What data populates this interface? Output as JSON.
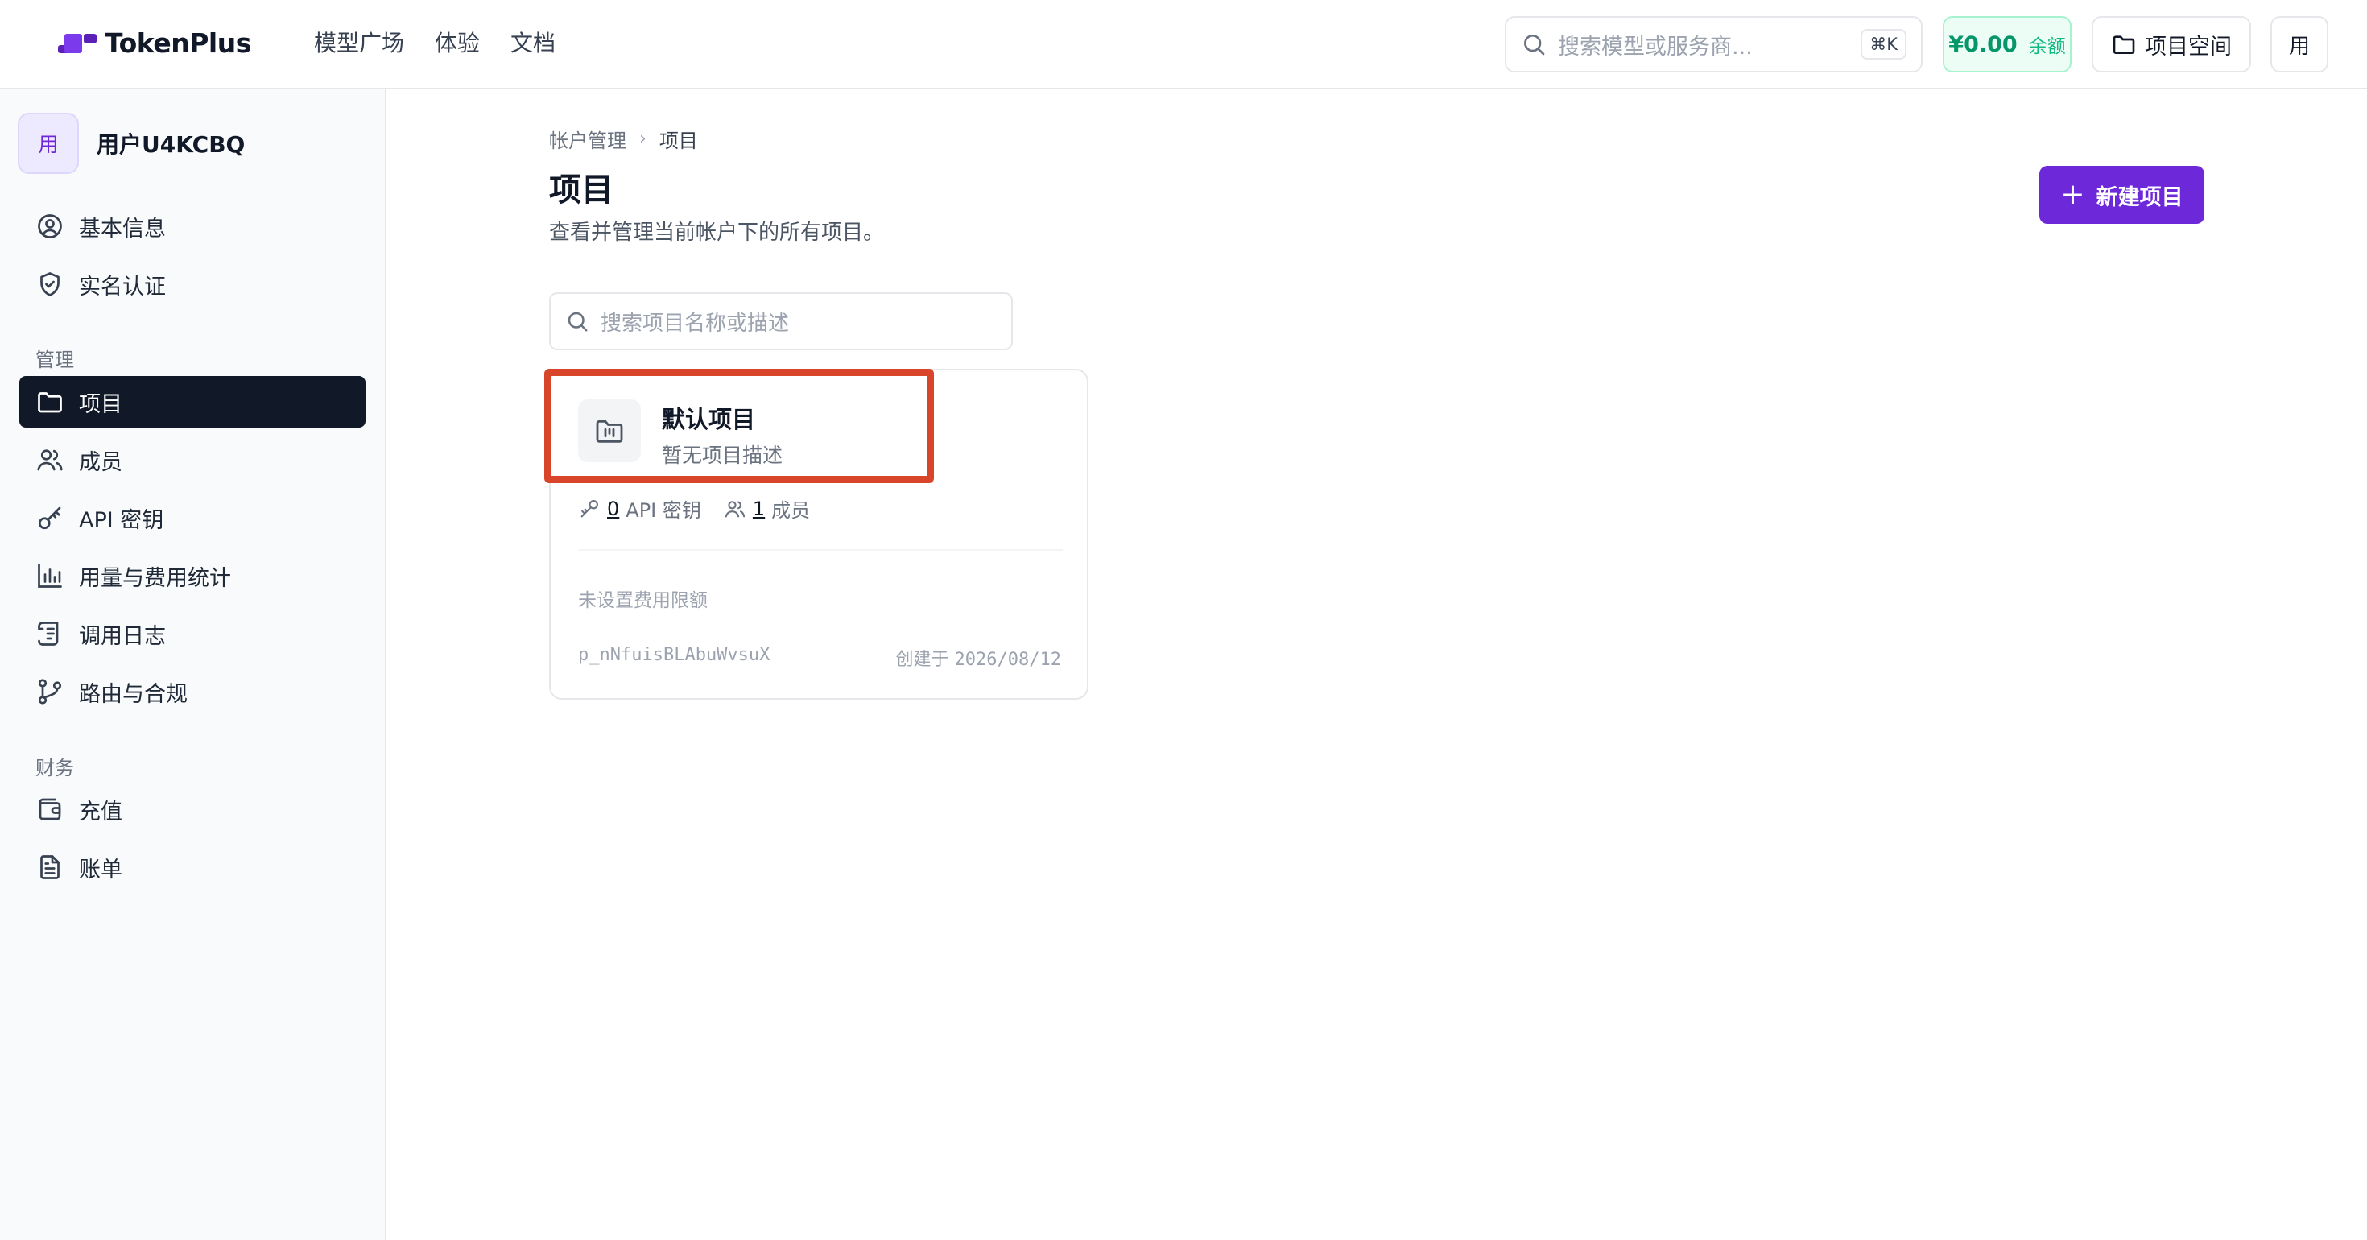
{
  "header": {
    "logo_text": "TokenPlus",
    "nav": [
      "模型广场",
      "体验",
      "文档"
    ],
    "search_placeholder": "搜索模型或服务商...",
    "search_shortcut": "⌘K",
    "balance_amount": "¥0.00",
    "balance_label": "余额",
    "workspace_label": "项目空间",
    "user_initial": "用"
  },
  "sidebar": {
    "avatar": "用",
    "username": "用户U4KCBQ",
    "items_top": [
      {
        "label": "基本信息",
        "icon": "user-circle-icon"
      },
      {
        "label": "实名认证",
        "icon": "shield-check-icon"
      }
    ],
    "section_manage": "管理",
    "items_manage": [
      {
        "label": "项目",
        "icon": "folder-icon",
        "active": true
      },
      {
        "label": "成员",
        "icon": "users-icon"
      },
      {
        "label": "API 密钥",
        "icon": "key-icon"
      },
      {
        "label": "用量与费用统计",
        "icon": "bar-chart-icon"
      },
      {
        "label": "调用日志",
        "icon": "scroll-icon"
      },
      {
        "label": "路由与合规",
        "icon": "git-branch-icon"
      }
    ],
    "section_finance": "财务",
    "items_finance": [
      {
        "label": "充值",
        "icon": "wallet-icon"
      },
      {
        "label": "账单",
        "icon": "file-text-icon"
      }
    ]
  },
  "main": {
    "breadcrumb": [
      "帐户管理",
      "项目"
    ],
    "title": "项目",
    "description": "查看并管理当前帐户下的所有项目。",
    "new_button": "新建项目",
    "search_placeholder": "搜索项目名称或描述",
    "projects": [
      {
        "name": "默认项目",
        "description": "暂无项目描述",
        "api_keys_count": "0",
        "api_keys_label": "API 密钥",
        "members_count": "1",
        "members_label": "成员",
        "limit_text": "未设置费用限额",
        "id": "p_nNfuisBLAbuWvsuX",
        "created_label": "创建于",
        "created_date": "2026/08/12"
      }
    ]
  }
}
